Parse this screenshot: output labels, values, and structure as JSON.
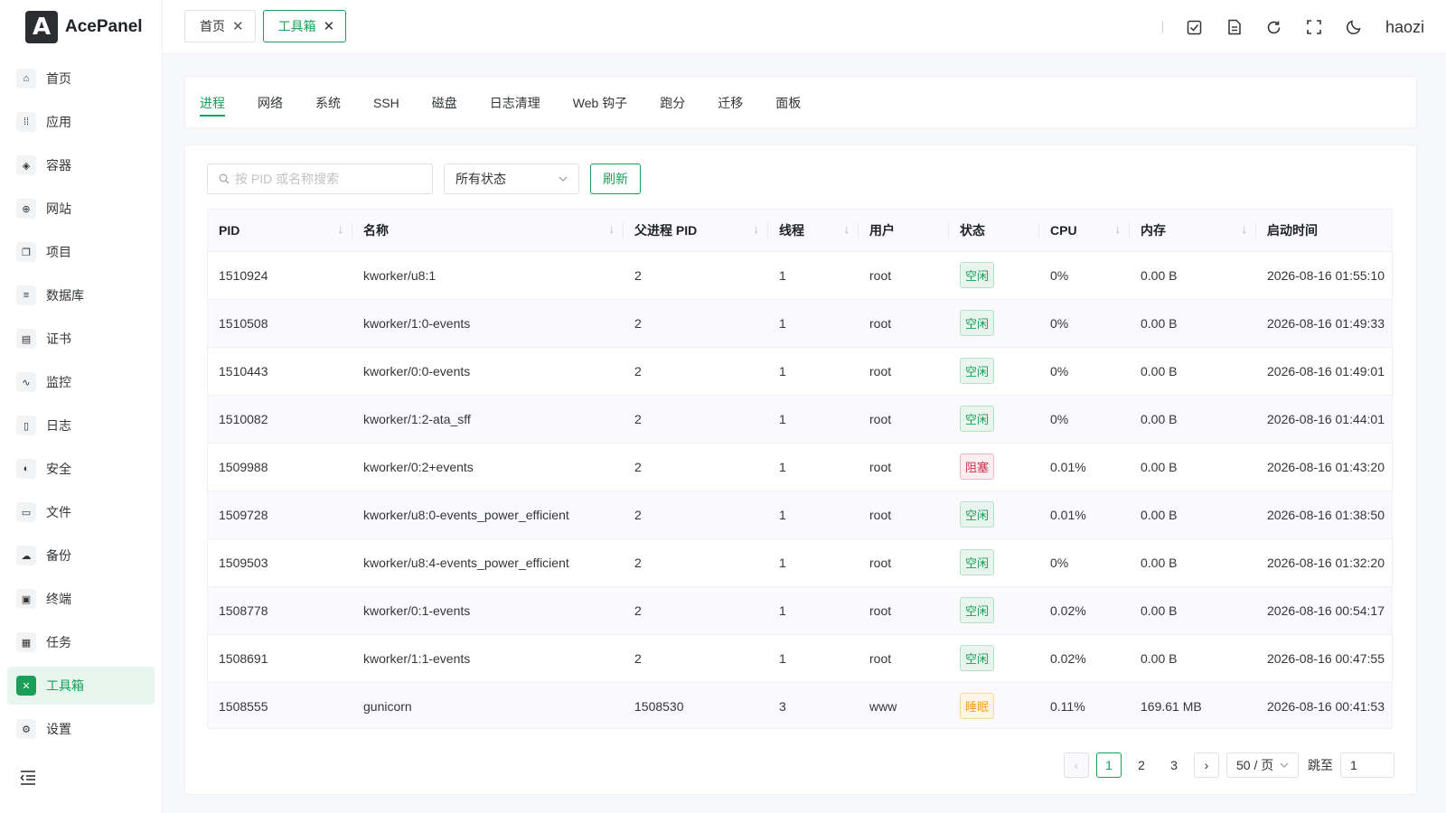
{
  "app": {
    "name": "AcePanel",
    "logo_letter": "A"
  },
  "sidebar": {
    "items": [
      {
        "key": "home",
        "label": "首页",
        "icon": "home-icon",
        "glyph": "⌂"
      },
      {
        "key": "apps",
        "label": "应用",
        "icon": "apps-grid-icon",
        "glyph": "⁞⁞"
      },
      {
        "key": "container",
        "label": "容器",
        "icon": "layers-icon",
        "glyph": "◈"
      },
      {
        "key": "website",
        "label": "网站",
        "icon": "globe-icon",
        "glyph": "⊕"
      },
      {
        "key": "project",
        "label": "项目",
        "icon": "folder-stack-icon",
        "glyph": "❐"
      },
      {
        "key": "database",
        "label": "数据库",
        "icon": "database-icon",
        "glyph": "≡"
      },
      {
        "key": "cert",
        "label": "证书",
        "icon": "certificate-icon",
        "glyph": "▤"
      },
      {
        "key": "monitor",
        "label": "监控",
        "icon": "chart-line-icon",
        "glyph": "∿"
      },
      {
        "key": "log",
        "label": "日志",
        "icon": "document-icon",
        "glyph": "▯"
      },
      {
        "key": "security",
        "label": "安全",
        "icon": "shield-icon",
        "glyph": "◐"
      },
      {
        "key": "files",
        "label": "文件",
        "icon": "folder-open-icon",
        "glyph": "▭"
      },
      {
        "key": "backup",
        "label": "备份",
        "icon": "cloud-backup-icon",
        "glyph": "☁"
      },
      {
        "key": "terminal",
        "label": "终端",
        "icon": "terminal-icon",
        "glyph": "▣"
      },
      {
        "key": "tasks",
        "label": "任务",
        "icon": "calendar-tasks-icon",
        "glyph": "▦"
      },
      {
        "key": "toolbox",
        "label": "工具箱",
        "icon": "tools-icon",
        "glyph": "✕",
        "active": true
      },
      {
        "key": "settings",
        "label": "设置",
        "icon": "gear-icon",
        "glyph": "⚙"
      }
    ]
  },
  "header": {
    "tabs": [
      {
        "label": "首页",
        "active": false
      },
      {
        "label": "工具箱",
        "active": true
      }
    ],
    "username": "haozi"
  },
  "tool_tabs": [
    "进程",
    "网络",
    "系统",
    "SSH",
    "磁盘",
    "日志清理",
    "Web 钩子",
    "跑分",
    "迁移",
    "面板"
  ],
  "filters": {
    "search_placeholder": "按 PID 或名称搜索",
    "status_value": "所有状态",
    "refresh_label": "刷新"
  },
  "table": {
    "columns": [
      {
        "label": "PID",
        "sortable": true
      },
      {
        "label": "名称",
        "sortable": true
      },
      {
        "label": "父进程 PID",
        "sortable": true
      },
      {
        "label": "线程",
        "sortable": true
      },
      {
        "label": "用户",
        "sortable": false
      },
      {
        "label": "状态",
        "sortable": false
      },
      {
        "label": "CPU",
        "sortable": true
      },
      {
        "label": "内存",
        "sortable": true
      },
      {
        "label": "启动时间",
        "sortable": false
      }
    ],
    "rows": [
      {
        "pid": "1510924",
        "name": "kworker/u8:1",
        "ppid": "2",
        "threads": "1",
        "user": "root",
        "status": "空闲",
        "status_type": "idle",
        "cpu": "0%",
        "mem": "0.00 B",
        "start": "2026-08-16 01:55:10"
      },
      {
        "pid": "1510508",
        "name": "kworker/1:0-events",
        "ppid": "2",
        "threads": "1",
        "user": "root",
        "status": "空闲",
        "status_type": "idle",
        "cpu": "0%",
        "mem": "0.00 B",
        "start": "2026-08-16 01:49:33"
      },
      {
        "pid": "1510443",
        "name": "kworker/0:0-events",
        "ppid": "2",
        "threads": "1",
        "user": "root",
        "status": "空闲",
        "status_type": "idle",
        "cpu": "0%",
        "mem": "0.00 B",
        "start": "2026-08-16 01:49:01"
      },
      {
        "pid": "1510082",
        "name": "kworker/1:2-ata_sff",
        "ppid": "2",
        "threads": "1",
        "user": "root",
        "status": "空闲",
        "status_type": "idle",
        "cpu": "0%",
        "mem": "0.00 B",
        "start": "2026-08-16 01:44:01"
      },
      {
        "pid": "1509988",
        "name": "kworker/0:2+events",
        "ppid": "2",
        "threads": "1",
        "user": "root",
        "status": "阻塞",
        "status_type": "blocked",
        "cpu": "0.01%",
        "mem": "0.00 B",
        "start": "2026-08-16 01:43:20"
      },
      {
        "pid": "1509728",
        "name": "kworker/u8:0-events_power_efficient",
        "ppid": "2",
        "threads": "1",
        "user": "root",
        "status": "空闲",
        "status_type": "idle",
        "cpu": "0.01%",
        "mem": "0.00 B",
        "start": "2026-08-16 01:38:50"
      },
      {
        "pid": "1509503",
        "name": "kworker/u8:4-events_power_efficient",
        "ppid": "2",
        "threads": "1",
        "user": "root",
        "status": "空闲",
        "status_type": "idle",
        "cpu": "0%",
        "mem": "0.00 B",
        "start": "2026-08-16 01:32:20"
      },
      {
        "pid": "1508778",
        "name": "kworker/0:1-events",
        "ppid": "2",
        "threads": "1",
        "user": "root",
        "status": "空闲",
        "status_type": "idle",
        "cpu": "0.02%",
        "mem": "0.00 B",
        "start": "2026-08-16 00:54:17"
      },
      {
        "pid": "1508691",
        "name": "kworker/1:1-events",
        "ppid": "2",
        "threads": "1",
        "user": "root",
        "status": "空闲",
        "status_type": "idle",
        "cpu": "0.02%",
        "mem": "0.00 B",
        "start": "2026-08-16 00:47:55"
      },
      {
        "pid": "1508555",
        "name": "gunicorn",
        "ppid": "1508530",
        "threads": "3",
        "user": "www",
        "status": "睡眠",
        "status_type": "sleep",
        "cpu": "0.11%",
        "mem": "169.61 MB",
        "start": "2026-08-16 00:41:53"
      }
    ]
  },
  "pagination": {
    "prev": "‹",
    "next": "›",
    "pages": [
      "1",
      "2",
      "3"
    ],
    "current": "1",
    "page_size": "50 / 页",
    "jump_label": "跳至",
    "jump_value": "1"
  },
  "colors": {
    "accent": "#18a058",
    "blocked": "#d03050",
    "sleep": "#f0a020"
  }
}
